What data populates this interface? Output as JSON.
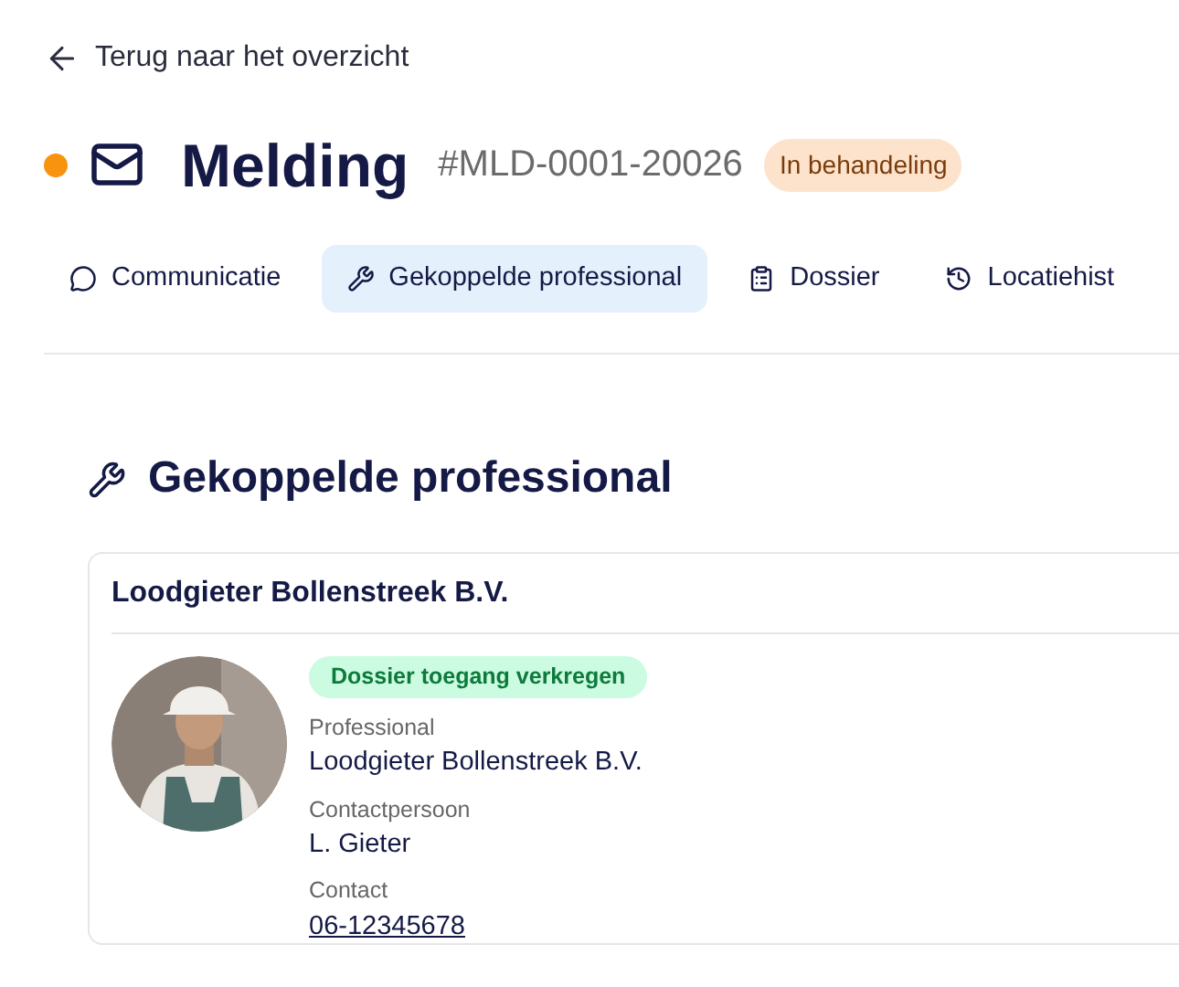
{
  "back_link": "Terug naar het overzicht",
  "header": {
    "title": "Melding",
    "reference": "#MLD-0001-20026",
    "status": "In behandeling"
  },
  "tabs": [
    {
      "label": "Communicatie",
      "kind": "message",
      "selected": false
    },
    {
      "label": "Gekoppelde professional",
      "kind": "wrench",
      "selected": true
    },
    {
      "label": "Dossier",
      "kind": "clipboard",
      "selected": false
    },
    {
      "label": "Locatiehist",
      "kind": "history",
      "selected": false
    }
  ],
  "section": {
    "title": "Gekoppelde professional"
  },
  "card": {
    "title": "Loodgieter Bollenstreek B.V.",
    "badge": "Dossier toegang verkregen",
    "fields": [
      {
        "label": "Professional",
        "value": "Loodgieter Bollenstreek B.V.",
        "kind": "text"
      },
      {
        "label": "Contactpersoon",
        "value": "L. Gieter",
        "kind": "text"
      },
      {
        "label": "Contact",
        "value": "06-12345678",
        "kind": "link"
      }
    ]
  }
}
